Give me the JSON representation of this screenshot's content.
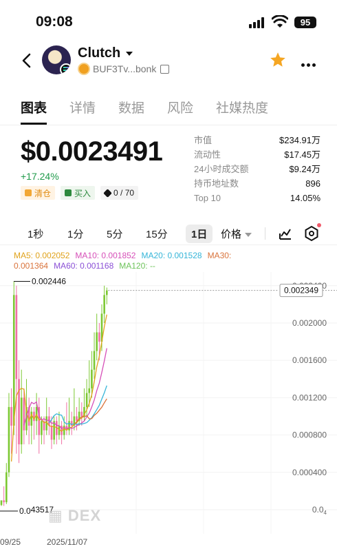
{
  "status": {
    "time": "09:08",
    "battery": "95"
  },
  "token": {
    "name": "Clutch",
    "address": "BUF3Tv...bonk"
  },
  "tabs": [
    "图表",
    "详情",
    "数据",
    "风险",
    "社媒热度"
  ],
  "price": {
    "value": "$0.0023491",
    "change": "+17.24%",
    "chip_clear": "清仓",
    "chip_buy": "买入",
    "chip_holders": "0 / 70"
  },
  "stats": [
    {
      "label": "市值",
      "value": "$234.91万"
    },
    {
      "label": "流动性",
      "value": "$17.45万"
    },
    {
      "label": "24小时成交额",
      "value": "$9.24万"
    },
    {
      "label": "持币地址数",
      "value": "896"
    },
    {
      "label": "Top 10",
      "value": "14.05%"
    }
  ],
  "intervals": [
    "1秒",
    "1分",
    "5分",
    "15分",
    "1日"
  ],
  "price_selector": "价格",
  "ma": {
    "ma5": "MA5: 0.002052",
    "ma10": "MA10: 0.001852",
    "ma20": "MA20: 0.001528",
    "ma30_a": "MA30:",
    "ma30_b": "0.001364",
    "ma60": "MA60: 0.001168",
    "ma120": "MA120: --"
  },
  "colors": {
    "up": "#7cc832",
    "down": "#f06fa4",
    "ma5": "#e0a21a",
    "ma10": "#d64fb8",
    "ma20": "#35b5d8",
    "ma30": "#d9733b",
    "ma60": "#8a4fd6",
    "ma120": "#6dc35a"
  },
  "chart_data": {
    "type": "line",
    "high_label": "0.002446",
    "low_label": "0.0",
    "low_suffix": "43517",
    "current_label": "0.002349",
    "y_ticks": [
      "0.002400",
      "0.002000",
      "0.001600",
      "0.001200",
      "0.000800",
      "0.000400",
      "0.0"
    ],
    "y_tick_values": [
      0.0024,
      0.002,
      0.0016,
      0.0012,
      0.0008,
      0.0004,
      0.0
    ],
    "y_tick_suffix_last": "4",
    "x_labels": [
      "09/25",
      "2025/11/07"
    ],
    "ylim": [
      0,
      0.0025
    ],
    "candles": [
      [
        5e-05,
        0.0001,
        0.0001,
        4e-05
      ],
      [
        0.0001,
        8e-05,
        0.00025,
        4e-05
      ],
      [
        8e-05,
        0.0004,
        0.0005,
        6e-05
      ],
      [
        0.0004,
        0.0011,
        0.00125,
        0.00035
      ],
      [
        0.0011,
        0.0009,
        0.0013,
        0.0006
      ],
      [
        0.0009,
        0.0023,
        0.002446,
        0.0008
      ],
      [
        0.0023,
        0.0014,
        0.0024,
        0.0006
      ],
      [
        0.0014,
        0.0007,
        0.0016,
        0.0005
      ],
      [
        0.0007,
        0.0012,
        0.0015,
        0.0006
      ],
      [
        0.0012,
        0.00085,
        0.0013,
        0.0007
      ],
      [
        0.00085,
        0.0011,
        0.0014,
        0.0008
      ],
      [
        0.0011,
        0.0009,
        0.0012,
        0.0007
      ],
      [
        0.0009,
        0.00105,
        0.0011,
        0.0007
      ],
      [
        0.00105,
        0.00095,
        0.0011,
        0.00075
      ],
      [
        0.00095,
        0.0011,
        0.00125,
        0.0008
      ],
      [
        0.0011,
        0.0008,
        0.0012,
        0.0006
      ],
      [
        0.0008,
        0.00095,
        0.001,
        0.0007
      ],
      [
        0.00095,
        0.00085,
        0.001,
        0.0007
      ],
      [
        0.00085,
        0.001,
        0.0012,
        0.0008
      ],
      [
        0.001,
        0.0009,
        0.0011,
        0.0008
      ],
      [
        0.0009,
        0.00075,
        0.001,
        0.00065
      ],
      [
        0.00075,
        0.00095,
        0.001,
        0.0007
      ],
      [
        0.00095,
        0.0008,
        0.001,
        0.0007
      ],
      [
        0.0008,
        0.0009,
        0.00105,
        0.00075
      ],
      [
        0.0009,
        0.0008,
        0.00095,
        0.0007
      ],
      [
        0.0008,
        0.0009,
        0.001,
        0.00075
      ],
      [
        0.0009,
        0.00085,
        0.00115,
        0.0008
      ],
      [
        0.00085,
        0.00095,
        0.0012,
        0.0008
      ],
      [
        0.00095,
        0.0009,
        0.00105,
        0.0008
      ],
      [
        0.0009,
        0.001,
        0.0013,
        0.00085
      ],
      [
        0.001,
        0.00095,
        0.0011,
        0.00085
      ],
      [
        0.00095,
        0.00105,
        0.0012,
        0.0009
      ],
      [
        0.00105,
        0.001,
        0.00115,
        0.0009
      ],
      [
        0.001,
        0.0011,
        0.0013,
        0.00095
      ],
      [
        0.0011,
        0.00125,
        0.0014,
        0.001
      ],
      [
        0.00125,
        0.0013,
        0.0016,
        0.0011
      ],
      [
        0.0013,
        0.0015,
        0.0017,
        0.0012
      ],
      [
        0.0015,
        0.0017,
        0.0019,
        0.0014
      ],
      [
        0.0017,
        0.0019,
        0.0021,
        0.0016
      ],
      [
        0.0019,
        0.0018,
        0.002,
        0.0016
      ],
      [
        0.0018,
        0.0021,
        0.0022,
        0.0017
      ],
      [
        0.0021,
        0.0023,
        0.0024,
        0.002
      ],
      [
        0.0023,
        0.002349,
        0.00238,
        0.0022
      ]
    ]
  },
  "watermark": "DEX"
}
